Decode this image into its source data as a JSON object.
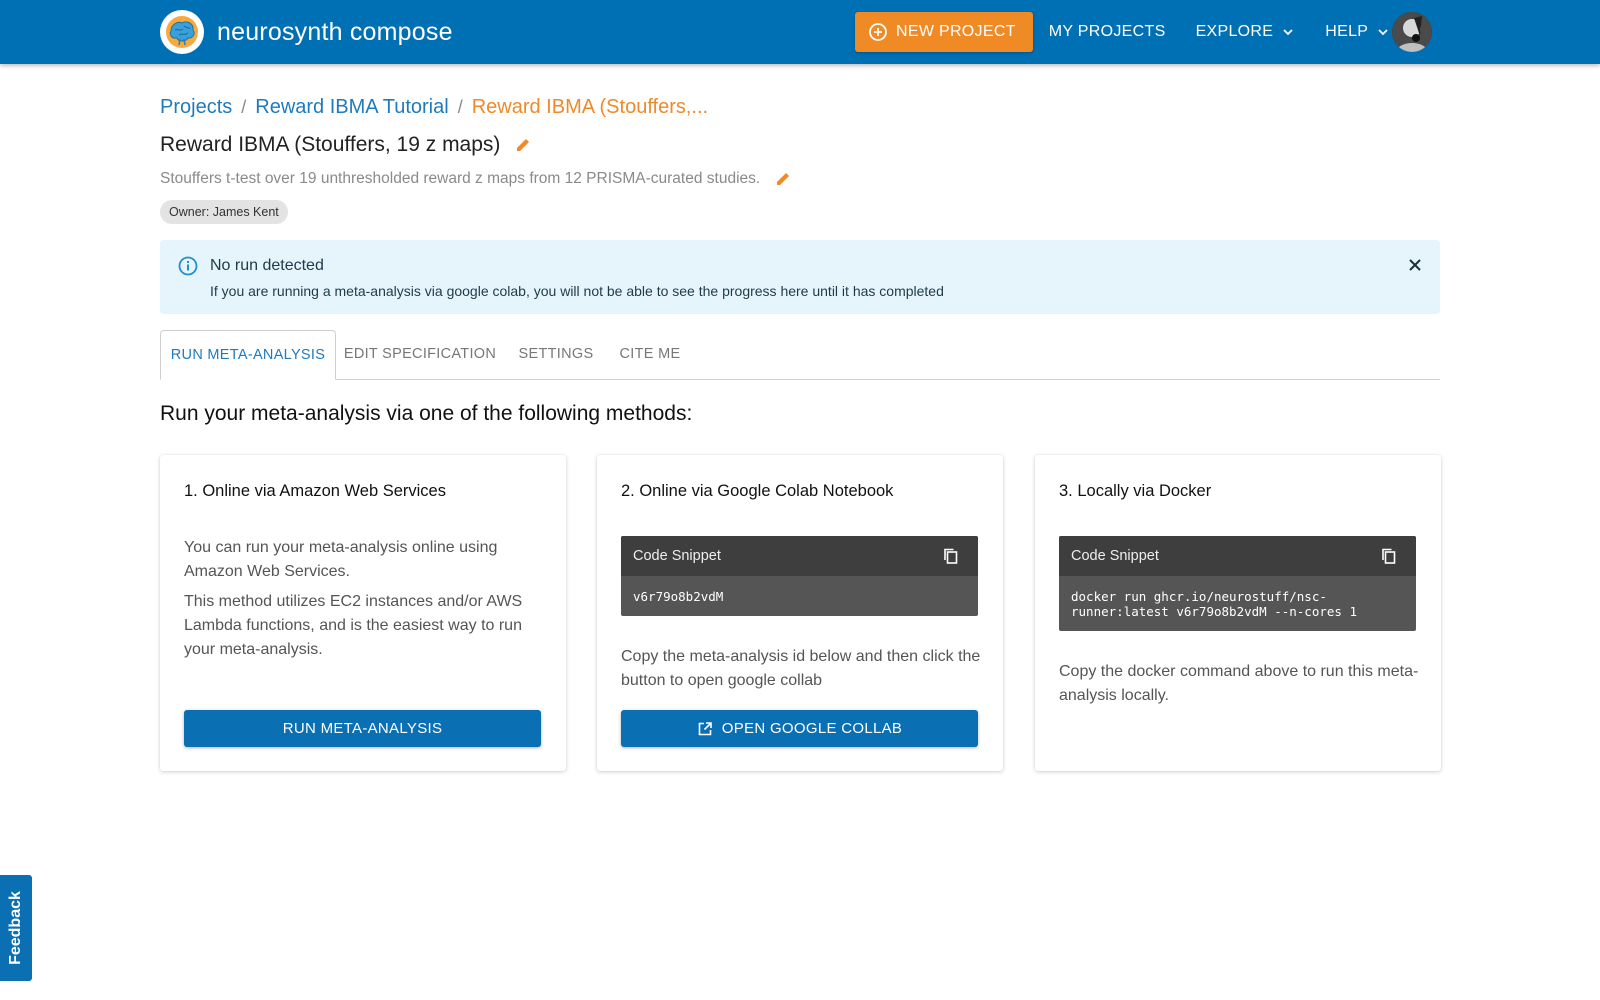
{
  "app": {
    "brand": "neurosynth compose"
  },
  "nav": {
    "new_project": "NEW PROJECT",
    "my_projects": "MY PROJECTS",
    "explore": "EXPLORE",
    "help": "HELP"
  },
  "breadcrumb": {
    "items": [
      "Projects",
      "Reward IBMA Tutorial"
    ],
    "current": "Reward IBMA (Stouffers,..."
  },
  "header": {
    "title": "Reward IBMA (Stouffers, 19 z maps)",
    "description": "Stouffers t-test over 19 unthresholded reward z maps from 12 PRISMA-curated studies.",
    "owner": "Owner: James Kent"
  },
  "alert": {
    "title": "No run detected",
    "text": "If you are running a meta-analysis via google colab, you will not be able to see the progress here until it has completed"
  },
  "tabs": [
    {
      "label": "RUN META-ANALYSIS",
      "active": true
    },
    {
      "label": "EDIT SPECIFICATION",
      "active": false
    },
    {
      "label": "SETTINGS",
      "active": false
    },
    {
      "label": "CITE ME",
      "active": false
    }
  ],
  "main": {
    "heading": "Run your meta-analysis via one of the following methods:",
    "cards": [
      {
        "title": "1. Online via Amazon Web Services",
        "paragraphs": [
          "You can run your meta-analysis online using Amazon Web Services.",
          "This method utilizes EC2 instances and/or AWS Lambda functions, and is the easiest way to run your meta-analysis."
        ],
        "button": "RUN META-ANALYSIS"
      },
      {
        "title": "2. Online via Google Colab Notebook",
        "snippet_label": "Code Snippet",
        "snippet_code": "v6r79o8b2vdM",
        "text": "Copy the meta-analysis id below and then click the button to open google collab",
        "button": "OPEN GOOGLE COLLAB"
      },
      {
        "title": "3. Locally via Docker",
        "snippet_label": "Code Snippet",
        "snippet_code": "docker run ghcr.io/neurostuff/nsc-runner:latest v6r79o8b2vdM --n-cores 1",
        "text": "Copy the docker command above to run this meta-analysis locally."
      }
    ]
  },
  "feedback": "Feedback",
  "colors": {
    "topbar": "#0070b5",
    "accent_orange": "#f08a24",
    "link": "#1f7bbd",
    "button_blue": "#0b6fb4",
    "alert_bg": "#e6f5fb"
  }
}
